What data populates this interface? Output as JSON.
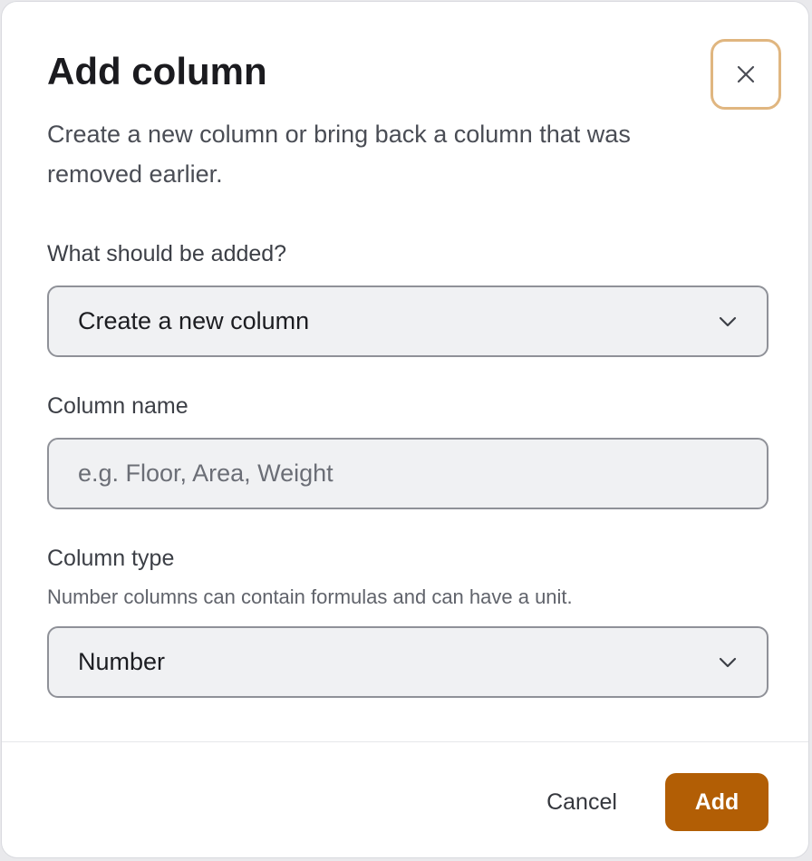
{
  "dialog": {
    "title": "Add column",
    "description": "Create a new column or bring back a column that was removed earlier.",
    "close_icon": "close-icon"
  },
  "fields": {
    "add_mode": {
      "label": "What should be added?",
      "selected": "Create a new column",
      "icon": "chevron-down-icon"
    },
    "column_name": {
      "label": "Column name",
      "value": "",
      "placeholder": "e.g. Floor, Area, Weight"
    },
    "column_type": {
      "label": "Column type",
      "hint": "Number columns can contain formulas and can have a unit.",
      "selected": "Number",
      "icon": "chevron-down-icon"
    }
  },
  "footer": {
    "cancel_label": "Cancel",
    "add_label": "Add"
  },
  "colors": {
    "accent": "#b25e05",
    "focus_ring": "#e0b680",
    "field_background": "#f0f1f3",
    "field_border": "#8f9198"
  }
}
